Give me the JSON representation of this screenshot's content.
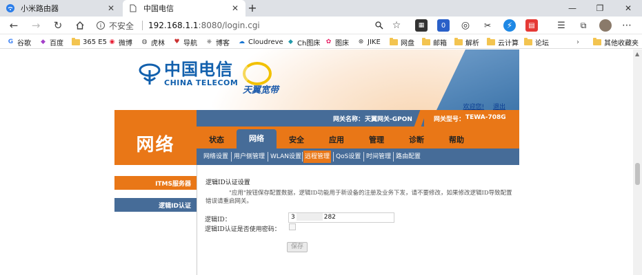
{
  "browser": {
    "tabs": [
      {
        "title": "小米路由器",
        "active": false,
        "icon": "wifi-icon"
      },
      {
        "title": "中国电信",
        "active": true,
        "icon": "page-icon"
      }
    ],
    "new_tab_symbol": "+",
    "window_controls": {
      "minimize": "—",
      "restore": "❐",
      "close": "✕"
    },
    "security_label": "不安全",
    "url_host": "192.168.1.1",
    "url_rest": ":8080/login.cgi",
    "bookmarks": [
      {
        "label": "谷歌",
        "icon": "google-icon"
      },
      {
        "label": "百度",
        "icon": "baidu-icon"
      },
      {
        "label": "365 E5",
        "icon": "folder-icon"
      },
      {
        "label": "微博",
        "icon": "weibo-icon"
      },
      {
        "label": "虎林",
        "icon": "hulin-icon"
      },
      {
        "label": "导航",
        "icon": "nav-icon"
      },
      {
        "label": "博客",
        "icon": "blog-icon"
      },
      {
        "label": "Cloudreve",
        "icon": "cloudreve-icon"
      },
      {
        "label": "Ch图床",
        "icon": "chtuchuang-icon"
      },
      {
        "label": "图床",
        "icon": "tuchuang-icon"
      },
      {
        "label": "JIKE",
        "icon": "jike-icon"
      },
      {
        "label": "网盘",
        "icon": "folder-icon"
      },
      {
        "label": "邮箱",
        "icon": "folder-icon"
      },
      {
        "label": "解析",
        "icon": "folder-icon"
      },
      {
        "label": "云计算",
        "icon": "folder-icon"
      },
      {
        "label": "论坛",
        "icon": "folder-icon"
      }
    ],
    "other_bookmarks": "其他收藏夹"
  },
  "page": {
    "logo": {
      "cn": "中国电信",
      "en": "CHINA TELECOM",
      "tianyi": "天翼宽带"
    },
    "welcome": "欢迎您!",
    "logout": "退出",
    "gateway_name_label": "网关名称：",
    "gateway_name": "天翼网关-GPON",
    "gateway_model_label": "网关型号：",
    "gateway_model": "TEWA-708G",
    "section_title": "网络",
    "main_nav": [
      "状态",
      "网络",
      "安全",
      "应用",
      "管理",
      "诊断",
      "帮助"
    ],
    "main_nav_active": "网络",
    "sub_nav": [
      "网络设置",
      "用户侧管理",
      "WLAN设置",
      "远程管理",
      "QoS设置",
      "时间管理",
      "路由配置"
    ],
    "sub_nav_active": "远程管理",
    "sidebar": [
      "ITMS服务器",
      "逻辑ID认证"
    ],
    "content": {
      "title": "逻辑ID认证设置",
      "note": "\"应用\"按钮保存配置数据，逻辑ID功能用于新设备的注册及业务下发，请不要修改，如果修改逻辑ID导致配置错误请重启网关。",
      "logic_id_label": "逻辑ID：",
      "logic_id_prefix": "3",
      "logic_id_suffix": "282",
      "use_password_label": "逻辑ID认证是否使用密码：",
      "save_button": "保存"
    }
  }
}
